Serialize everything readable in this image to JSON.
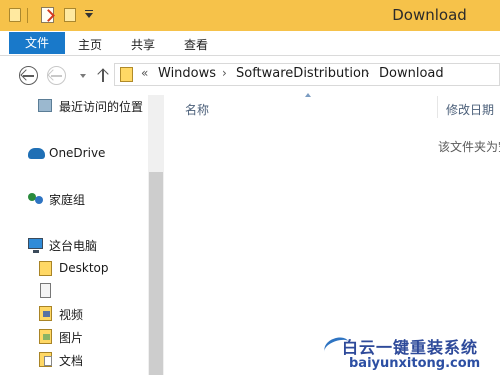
{
  "window": {
    "title": "Download"
  },
  "ribbon": {
    "tabs": [
      {
        "label": "文件"
      },
      {
        "label": "主页"
      },
      {
        "label": "共享"
      },
      {
        "label": "查看"
      }
    ]
  },
  "address": {
    "overflow": "«",
    "breadcrumbs": [
      "Windows",
      "SoftwareDistribution",
      "Download"
    ],
    "separator": "›"
  },
  "nav_pane": {
    "items": [
      {
        "label": "最近访问的位置",
        "icon": "recent-places-icon"
      },
      {
        "label": "OneDrive",
        "icon": "onedrive-icon"
      },
      {
        "label": "家庭组",
        "icon": "homegroup-icon"
      },
      {
        "label": "这台电脑",
        "icon": "this-pc-icon"
      },
      {
        "label": "Desktop",
        "icon": "folder-icon"
      },
      {
        "label": "",
        "icon": "document-icon"
      },
      {
        "label": "视频",
        "icon": "videos-folder-icon"
      },
      {
        "label": "图片",
        "icon": "pictures-folder-icon"
      },
      {
        "label": "文档",
        "icon": "documents-folder-icon"
      }
    ]
  },
  "content": {
    "columns": [
      {
        "label": "名称"
      },
      {
        "label": "修改日期"
      }
    ],
    "empty_message": "该文件夹为空。"
  },
  "watermark": {
    "title": "白云一键重装系统",
    "url": "baiyunxitong.com"
  },
  "colors": {
    "titlebar": "#f6c24a",
    "file_tab": "#1979ca",
    "watermark_text": "#2e4a9a"
  }
}
